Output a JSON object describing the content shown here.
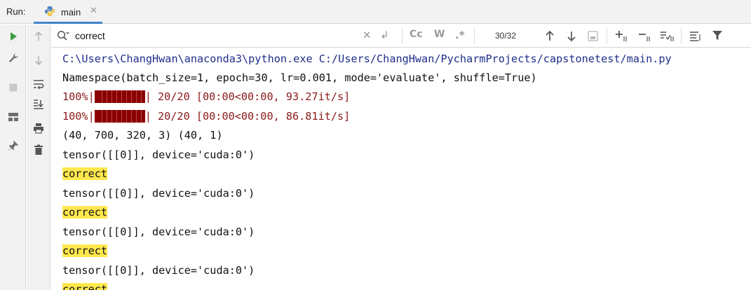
{
  "run_bar": {
    "label": "Run:",
    "tab_title": "main"
  },
  "search": {
    "query": "correct",
    "match_count": "30/32",
    "match_case_label": "Cc",
    "words_label": "W",
    "regex_label": ".*"
  },
  "console": {
    "command": "C:\\Users\\ChangHwan\\anaconda3\\python.exe C:/Users/ChangHwan/PycharmProjects/capstonetest/main.py",
    "namespace": "Namespace(batch_size=1, epoch=30, lr=0.001, mode='evaluate', shuffle=True)",
    "progress": [
      {
        "prefix": "100%|",
        "suffix": "| 20/20 [00:00<00:00, 93.27it/s]",
        "fraction": 1.0
      },
      {
        "prefix": "100%|",
        "suffix": "| 20/20 [00:00<00:00, 86.81it/s]",
        "fraction": 1.0
      }
    ],
    "shape": "(40, 700, 320, 3) (40, 1)",
    "tensor_line": "tensor([[0]], device='cuda:0')",
    "match_word": "correct"
  },
  "colors": {
    "highlight": "#ffe84d",
    "progress_fill": "#8b0000",
    "path_text": "#1e2e8a",
    "stderr_text": "#8b1a1a",
    "tab_underline": "#4083c9",
    "run_green": "#3c9a3c"
  },
  "icons": {
    "run": "play-icon",
    "settings": "wrench-icon",
    "stop": "stop-icon",
    "layout": "layout-icon",
    "pin": "pin-icon",
    "up": "arrow-up-icon",
    "down": "arrow-down-icon",
    "wrap": "soft-wrap-icon",
    "scroll_end": "scroll-to-end-icon",
    "print": "print-icon",
    "trash": "trash-icon"
  }
}
